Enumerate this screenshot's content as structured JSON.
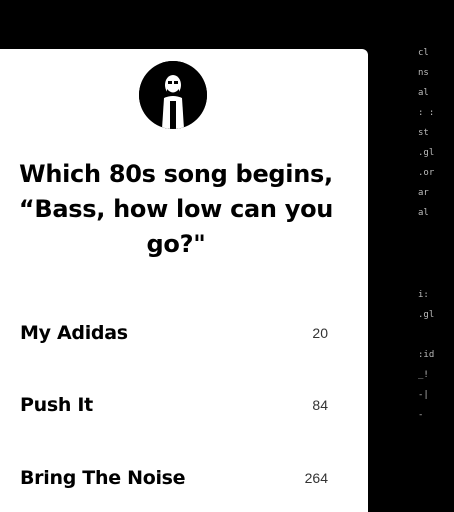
{
  "question": {
    "text": "Which 80s song begins, “Bass, how low can you go?\""
  },
  "options": [
    {
      "title": "My Adidas",
      "count": "20"
    },
    {
      "title": "Push It",
      "count": "84"
    },
    {
      "title": "Bring The Noise",
      "count": "264"
    }
  ],
  "side_fragments": [
    "cl",
    "ns",
    "al",
    ": :",
    "st",
    ".gl",
    ".or",
    "ar",
    "al",
    "i:",
    ".gl",
    ":id",
    "_!",
    "-|",
    "-"
  ],
  "colors": {
    "background": "#000000",
    "card": "#ffffff",
    "text": "#000000"
  },
  "avatar": {
    "icon": "person-avatar-icon"
  }
}
